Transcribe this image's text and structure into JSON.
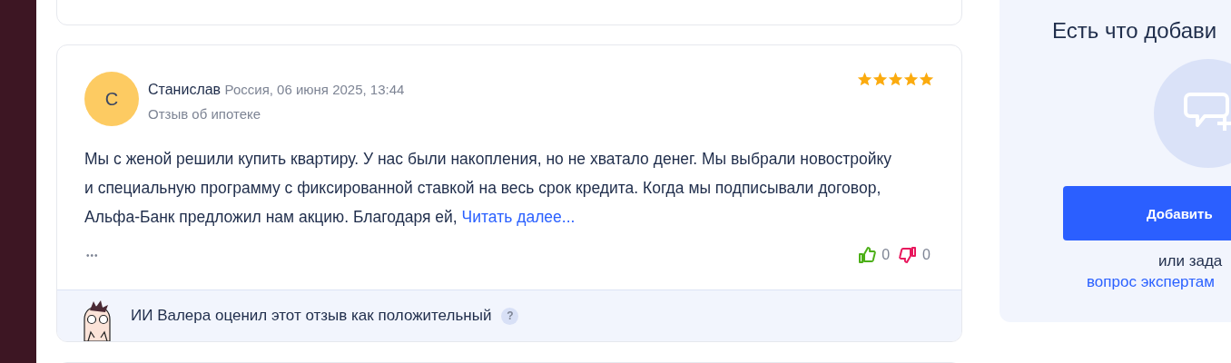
{
  "review": {
    "avatar_letter": "С",
    "author": "Станислав",
    "meta": "Россия, 06 июня 2025, 13:44",
    "topic": "Отзыв об ипотеке",
    "stars": 5,
    "text": "Мы с женой решили купить квартиру. У нас были накопления, но не хватало денег. Мы выбрали новостройку и специальную программу с фиксированной ставкой на весь срок кредита. Когда мы подписывали договор, Альфа-Банк предложил нам акцию. Благодаря ей,",
    "read_more": "Читать далее...",
    "more": "•••",
    "likes": "0",
    "dislikes": "0",
    "ai_verdict": "ИИ Валера оценил этот отзыв как положительный",
    "help": "?"
  },
  "sidebar": {
    "heading": "Есть что добави",
    "button": "Добавить",
    "ask_prefix": "или зада",
    "ask_link": "вопрос экспертам"
  }
}
